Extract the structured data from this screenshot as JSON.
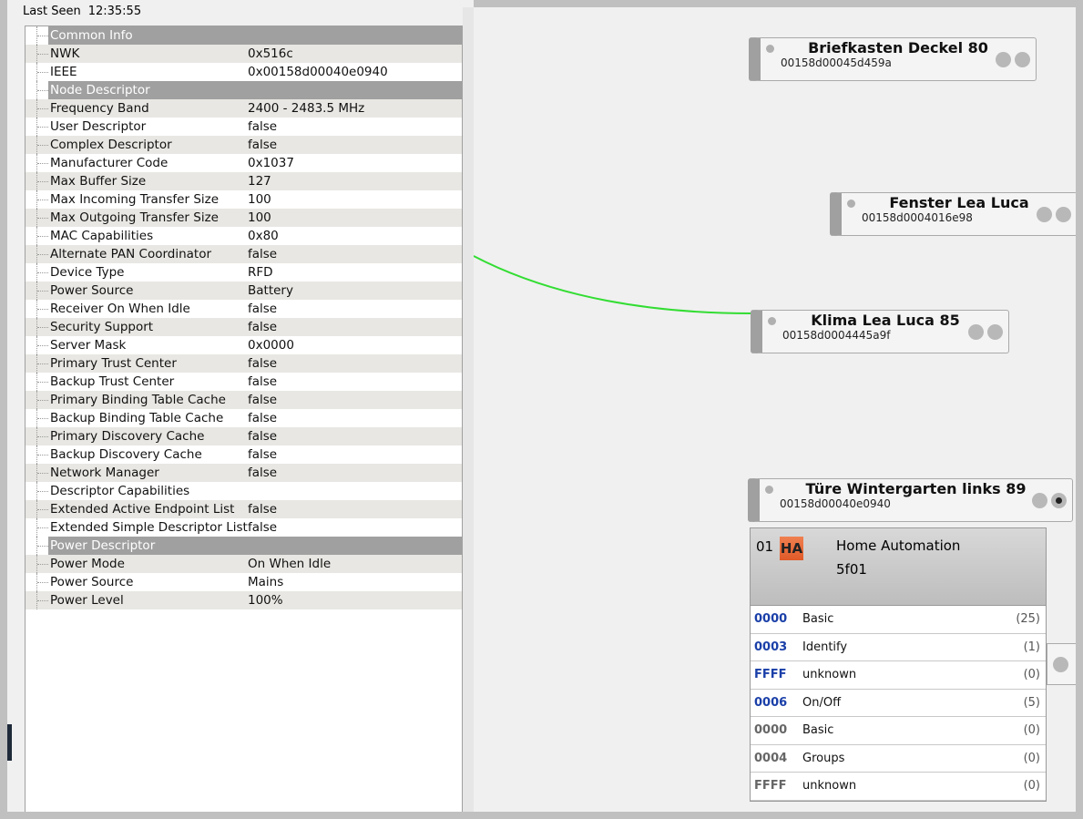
{
  "last_seen": {
    "label": "Last Seen",
    "value": "12:35:55"
  },
  "tree": [
    {
      "type": "header",
      "label": "Common Info"
    },
    {
      "label": "NWK",
      "value": "0x516c"
    },
    {
      "label": "IEEE",
      "value": "0x00158d00040e0940"
    },
    {
      "type": "header",
      "label": "Node Descriptor"
    },
    {
      "label": "Frequency Band",
      "value": "2400 - 2483.5 MHz"
    },
    {
      "label": "User Descriptor",
      "value": "false"
    },
    {
      "label": "Complex Descriptor",
      "value": "false"
    },
    {
      "label": "Manufacturer Code",
      "value": "0x1037"
    },
    {
      "label": "Max Buffer Size",
      "value": "127"
    },
    {
      "label": "Max Incoming Transfer Size",
      "value": "100"
    },
    {
      "label": "Max Outgoing Transfer Size",
      "value": "100"
    },
    {
      "label": "MAC Capabilities",
      "value": "0x80"
    },
    {
      "label": "Alternate PAN Coordinator",
      "value": "false"
    },
    {
      "label": "Device Type",
      "value": "RFD"
    },
    {
      "label": "Power Source",
      "value": "Battery"
    },
    {
      "label": "Receiver On When Idle",
      "value": "false"
    },
    {
      "label": "Security Support",
      "value": "false"
    },
    {
      "label": "Server Mask",
      "value": "0x0000"
    },
    {
      "label": "Primary Trust Center",
      "value": "false"
    },
    {
      "label": "Backup Trust Center",
      "value": "false"
    },
    {
      "label": "Primary Binding Table Cache",
      "value": "false"
    },
    {
      "label": "Backup Binding Table Cache",
      "value": "false"
    },
    {
      "label": "Primary Discovery Cache",
      "value": "false"
    },
    {
      "label": "Backup Discovery Cache",
      "value": "false"
    },
    {
      "label": "Network Manager",
      "value": "false"
    },
    {
      "label": "Descriptor Capabilities",
      "value": ""
    },
    {
      "label": "Extended Active Endpoint List",
      "value": "false"
    },
    {
      "label": "Extended Simple Descriptor List",
      "value": "false"
    },
    {
      "type": "header",
      "label": "Power Descriptor"
    },
    {
      "label": "Power Mode",
      "value": "On When Idle"
    },
    {
      "label": "Power Source",
      "value": "Mains"
    },
    {
      "label": "Power Level",
      "value": "100%"
    }
  ],
  "nodes": [
    {
      "name": "Briefkasten Deckel 80",
      "ieee": "00158d00045d459a"
    },
    {
      "name": "Fenster Lea Luca",
      "ieee": "00158d0004016e98"
    },
    {
      "name": "Klima Lea Luca 85",
      "ieee": "00158d0004445a9f"
    },
    {
      "name": "Türe Wintergarten links 89",
      "ieee": "00158d00040e0940"
    }
  ],
  "endpoint": {
    "number": "01",
    "profile_badge": "HA",
    "profile": "Home Automation",
    "device_id": "5f01",
    "clusters": [
      {
        "id": "0000",
        "name": "Basic",
        "count": "(25)",
        "side": "server"
      },
      {
        "id": "0003",
        "name": "Identify",
        "count": "(1)",
        "side": "server"
      },
      {
        "id": "FFFF",
        "name": "unknown",
        "count": "(0)",
        "side": "server"
      },
      {
        "id": "0006",
        "name": "On/Off",
        "count": "(5)",
        "side": "server"
      },
      {
        "id": "0000",
        "name": "Basic",
        "count": "(0)",
        "side": "client"
      },
      {
        "id": "0004",
        "name": "Groups",
        "count": "(0)",
        "side": "client"
      },
      {
        "id": "FFFF",
        "name": "unknown",
        "count": "(0)",
        "side": "client"
      }
    ]
  },
  "colors": {
    "link": "#33dd33",
    "server_cluster": "#1a3fa8",
    "client_cluster": "#666666",
    "ha_badge": "#e8683a"
  }
}
